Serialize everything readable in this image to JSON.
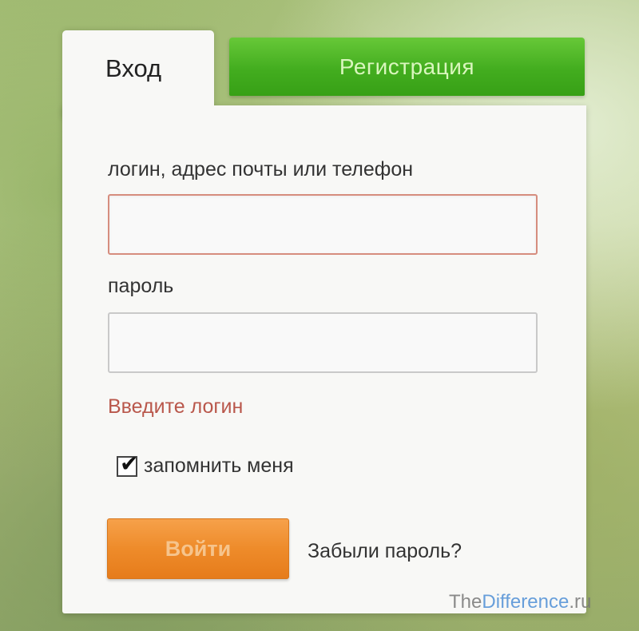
{
  "tabs": {
    "login_label": "Вход",
    "register_label": "Регистрация"
  },
  "form": {
    "login_field_label": "логин, адрес почты или телефон",
    "login_value": "",
    "password_field_label": "пароль",
    "password_value": "",
    "error_message": "Введите логин",
    "remember_label": "запомнить меня",
    "remember_checked": true,
    "submit_label": "Войти",
    "forgot_link": "Забыли пароль?"
  },
  "watermark": {
    "prefix": "The",
    "accent": "Difference",
    "suffix": ".ru"
  },
  "colors": {
    "register_green": "#43ad1f",
    "submit_orange": "#ee8b2a",
    "error_red": "#b9574b",
    "field_error_border": "#d68d7e"
  },
  "icons": {
    "checkbox_mark": "check-icon"
  }
}
